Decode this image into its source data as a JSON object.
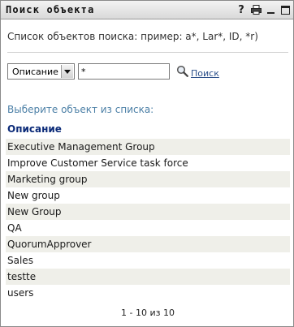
{
  "window": {
    "title": "Поиск объекта",
    "help_label": "?"
  },
  "hint": "Список объектов поиска: пример: a*, Lar*, ID, *r)",
  "search": {
    "attribute_selected": "Описание",
    "query_value": "*",
    "button_label": "Поиск"
  },
  "results": {
    "prompt": "Выберите объект из списка:",
    "column_header": "Описание",
    "items": [
      "Executive Management Group",
      "Improve Customer Service task force",
      "Marketing group",
      "New group",
      "New Group",
      "QA",
      "QuorumApprover",
      "Sales",
      "testte",
      "users"
    ],
    "pager": "1 - 10 из 10"
  },
  "colors": {
    "row_stripe": "#efefe9",
    "header_text": "#0b2a78",
    "prompt_text": "#4b7fa6",
    "link": "#2b4f8a"
  },
  "icons": [
    "help-icon",
    "print-icon",
    "minimize-icon",
    "maximize-icon",
    "search-icon"
  ]
}
